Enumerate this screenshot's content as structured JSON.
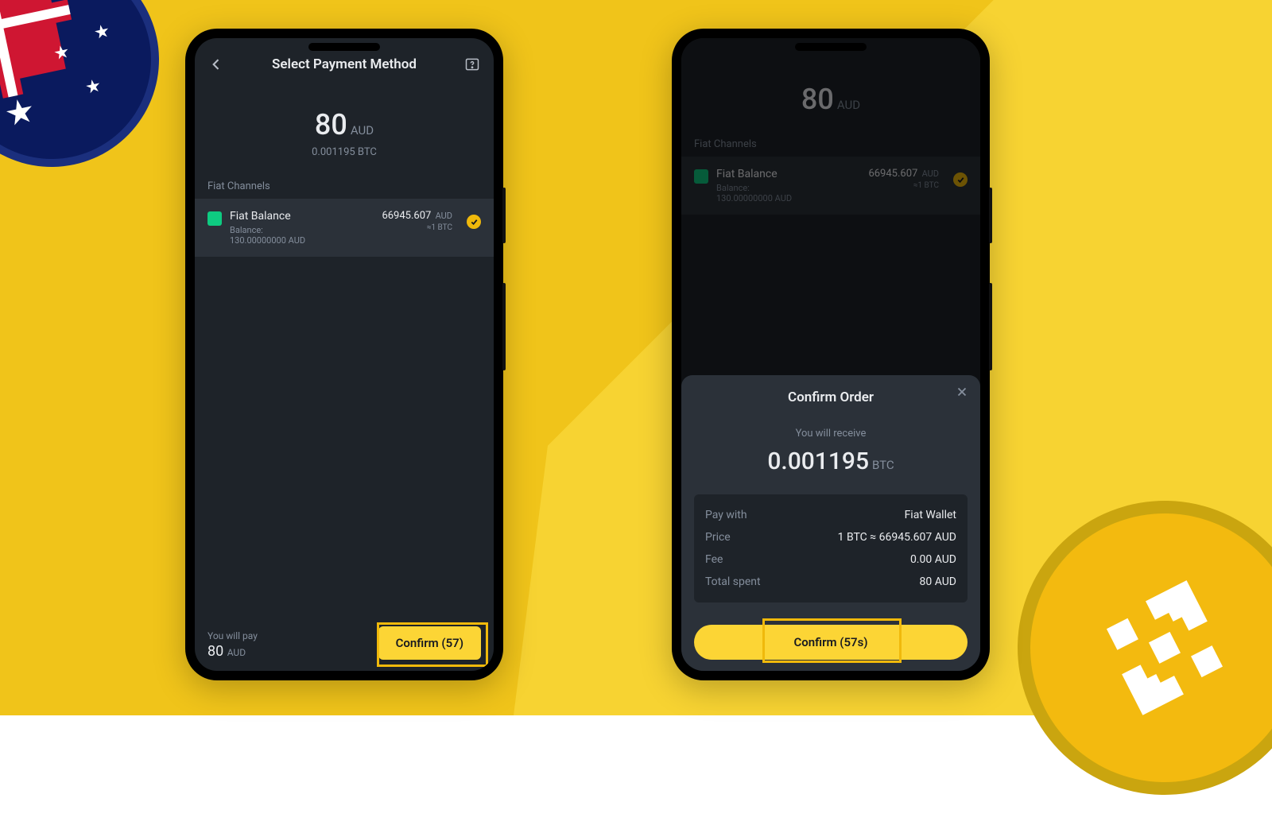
{
  "leftPhone": {
    "header": {
      "title": "Select Payment Method"
    },
    "amount": {
      "value": "80",
      "currency": "AUD",
      "sub": "0.001195 BTC"
    },
    "sectionLabel": "Fiat Channels",
    "channel": {
      "name": "Fiat Balance",
      "balanceLabel": "Balance:",
      "balanceValue": "130.00000000 AUD",
      "rate": "66945.607",
      "rateCurrency": "AUD",
      "rateSub": "≈1 BTC"
    },
    "footer": {
      "payLabel": "You will pay",
      "payAmount": "80",
      "payCurrency": "AUD",
      "confirm": "Confirm (57)"
    }
  },
  "rightPhone": {
    "amount": {
      "value": "80",
      "currency": "AUD"
    },
    "sectionLabel": "Fiat Channels",
    "channel": {
      "name": "Fiat Balance",
      "balanceLabel": "Balance:",
      "balanceValue": "130.00000000 AUD",
      "rate": "66945.607",
      "rateCurrency": "AUD",
      "rateSub": "≈1 BTC"
    },
    "sheet": {
      "title": "Confirm Order",
      "receiveLabel": "You will receive",
      "receiveValue": "0.001195",
      "receiveUnit": "BTC",
      "rows": {
        "payWith": {
          "k": "Pay with",
          "v": "Fiat Wallet"
        },
        "price": {
          "k": "Price",
          "v": "1 BTC ≈ 66945.607 AUD"
        },
        "fee": {
          "k": "Fee",
          "v": "0.00 AUD"
        },
        "total": {
          "k": "Total spent",
          "v": "80 AUD"
        }
      },
      "confirm": "Confirm (57s)"
    }
  }
}
